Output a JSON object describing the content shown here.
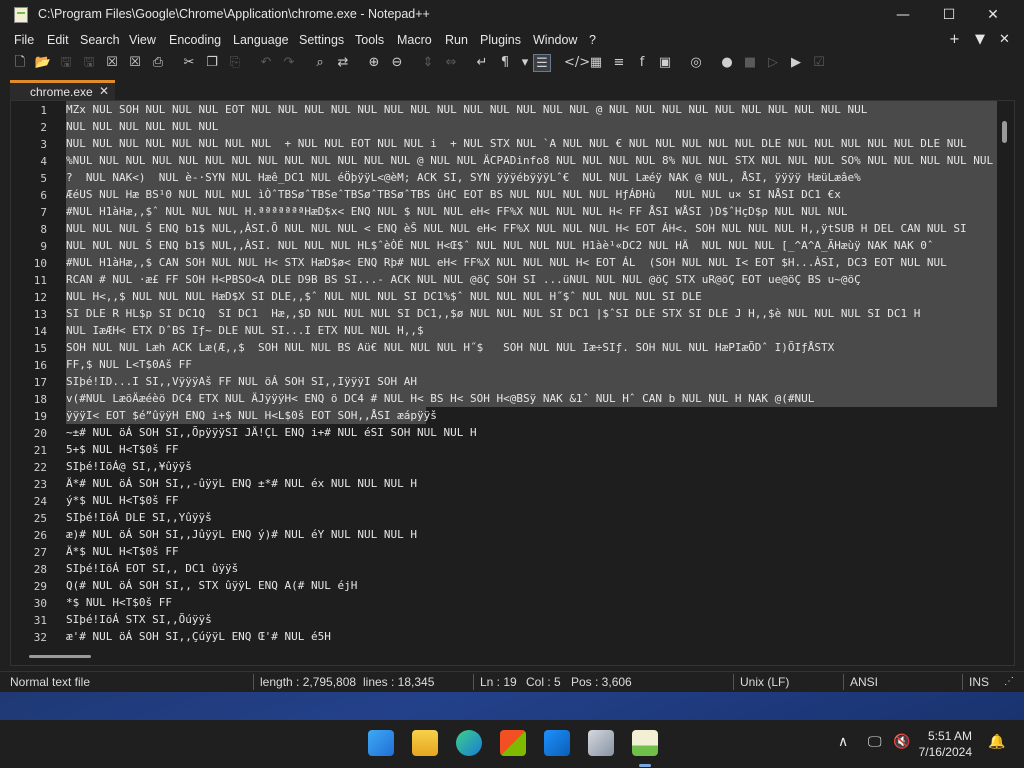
{
  "window": {
    "title": "C:\\Program Files\\Google\\Chrome\\Application\\chrome.exe - Notepad++",
    "minimize": "—",
    "maximize": "☐",
    "close": "✕"
  },
  "menu": {
    "items": [
      "File",
      "Edit",
      "Search",
      "View",
      "Encoding",
      "Language",
      "Settings",
      "Tools",
      "Macro",
      "Run",
      "Plugins",
      "Window",
      "?"
    ],
    "right_plus": "+",
    "right_down": "▼",
    "right_close": "✕"
  },
  "toolbar": {
    "icons": [
      "new-file-icon",
      "open-file-icon",
      "save-icon",
      "save-all-icon",
      "close-icon",
      "close-all-icon",
      "print-icon",
      "cut-icon",
      "copy-icon",
      "paste-icon",
      "undo-icon",
      "redo-icon",
      "find-icon",
      "replace-icon",
      "zoom-in-icon",
      "zoom-out-icon",
      "sync-vertical-icon",
      "sync-horizontal-icon",
      "word-wrap-icon",
      "show-all-chars-icon",
      "indent-guide-icon",
      "xml-tag-icon",
      "document-map-icon",
      "function-list-icon",
      "folder-workspace-icon",
      "monitoring-icon",
      "record-macro-icon",
      "stop-macro-icon",
      "play-macro-icon",
      "run-macro-icon",
      "save-macro-icon"
    ]
  },
  "tabs": [
    {
      "label": "chrome.exe",
      "close": "✕"
    }
  ],
  "editor": {
    "line_numbers": [
      "1",
      "2",
      "3",
      "4",
      "5",
      "6",
      "7",
      "8",
      "9",
      "10",
      "11",
      "12",
      "13",
      "14",
      "15",
      "16",
      "17",
      "18",
      "19",
      "20",
      "21",
      "22",
      "23",
      "24",
      "25",
      "26",
      "27",
      "28",
      "29",
      "30",
      "31",
      "32"
    ],
    "lines": [
      "MZx NUL SOH NUL NUL NUL EOT NUL NUL NUL NUL NUL NUL NUL NUL NUL NUL NUL NUL NUL @ NUL NUL NUL NUL NUL NUL NUL NUL NUL NUL",
      "NUL NUL NUL NUL NUL NUL",
      "NUL NUL NUL NUL NUL NUL NUL NUL  + NUL NUL EOT NUL NUL i  + NUL STX NUL `A NUL NUL € NUL NUL NUL NUL NUL DLE NUL NUL NUL NUL NUL DLE NUL",
      "%NUL NUL NUL NUL NUL NUL NUL NUL NUL NUL NUL NUL NUL @ NUL NUL ÄCPADinfo8 NUL NUL NUL NUL 8% NUL NUL STX NUL NUL NUL SO% NUL NUL NUL NUL NUL",
      "?  NUL NAK<)  NUL è-·SYN NUL Hæê_DC1 NUL éÖþÿÿL<@èM; ACK SI, SYN ÿÿÿébÿÿÿLˆ€  NUL NUL Læéÿ NAK @ NUL, ÅSI, ÿÿÿÿ HæüLæâe%",
      "ÆéUS NUL Hæ BS¹0 NUL NUL NUL ìÒˆTBSøˆTBSeˆTBSøˆTBSøˆTBS ûHC EOT BS NUL NUL NUL NUL HƒÁÐHù   NUL NUL u× SI NÅSI DC1 €x",
      "#NUL H1àHæ,,$ˆ NUL NUL NUL H.ªªªªªªªHæD$x< ENQ NUL $ NUL NUL eH< FF%X NUL NUL NUL H< FF ÅSI WÅSI )D$ˆHçD$p NUL NUL NUL",
      "NUL NUL NUL Š ENQ b1$ NUL,,ÀSI.Õ NUL NUL NUL < ENQ èŠ NUL NUL eH< FF%X NUL NUL NUL H< EOT ÁH<. SOH NUL NUL NUL H,,ÿtSUB H DEL CAN NUL SI",
      "NUL NUL NUL Š ENQ b1$ NUL,,ÀSI. NUL NUL NUL HL$ˆèÒÉ NUL H<Œ$ˆ NUL NUL NUL NUL H1àè¹«DC2 NUL HÄ  NUL NUL NUL [_^A^A_ÃHæùÿ NAK NAK 0ˆ",
      "#NUL H1àHæ,,$ CAN SOH NUL NUL H< STX HæD$ø< ENQ Rþ# NUL eH< FF%X NUL NUL NUL H< EOT ÁL  (SOH NUL NUL I< EOT $H...ÀSI, DC3 EOT NUL NUL",
      "RCAN # NUL ·æ£ FF SOH H<PBSO<A DLE D9B BS SI...- ACK NUL NUL @öÇ SOH SI ...üNUL NUL NUL @öÇ STX uR@öÇ EOT ue@öÇ BS u~@öÇ",
      "NUL H<,,$ NUL NUL NUL HæD$X SI DLE,,$ˆ NUL NUL NUL SI DC1%$ˆ NUL NUL NUL H˝$ˆ NUL NUL NUL SI DLE",
      "SI DLE R HL$p SI DC1Q  SI DC1  Hæ,,$D NUL NUL NUL SI DC1,,$ø NUL NUL NUL SI DC1 |$ˆSI DLE STX SI DLE J H,,$è NUL NUL NUL SI DC1 H",
      "NUL IæÆH< ETX DˆBS Iƒ~ DLE NUL SI...I ETX NUL NUL H,,$",
      "SOH NUL NUL Læh ACK Læ(Æ,,$  SOH NUL NUL BS Aü€ NUL NUL NUL H˝$   SOH NUL NUL Iæ÷SIƒ. SOH NUL NUL HæPIæÕDˆ I)ÕIƒÅSTX",
      "FF,$ NUL L<T$0Aš FF",
      "SIþé!ID...I SI,,VÿÿÿAš FF NUL öÁ SOH SI,,IÿÿÿI SOH AH",
      "v(#NUL LæöÄæéèö DC4 ETX NUL ÄJÿÿÿH< ENQ ö DC4 # NUL H< BS H< SOH H<@BSÿ NAK &1ˆ NUL Hˆ CAN b NUL NUL H NAK @(#NUL",
      "ÿÿÿI< EOT $é”ûÿÿH ENQ i+$ NUL H<L$0š EOT SOH,,ÅSI æápÿÿš",
      "~±# NUL öÁ SOH SI,,ÕpÿÿÿSI JÄ!ÇL ENQ i+# NUL éSI SOH NUL NUL H",
      "5+$ NUL H<T$0š FF",
      "SIþé!IöÁ@ SI,,¥ûÿÿš",
      "Ä*# NUL öÁ SOH SI,,-ûÿÿL ENQ ±*# NUL éx NUL NUL NUL H",
      "ý*$ NUL H<T$0š FF",
      "SIþé!IöÁ DLE SI,,Yûÿÿš",
      "æ)# NUL öÁ SOH SI,,JûÿÿL ENQ ý)# NUL éY NUL NUL NUL H",
      "Ä*$ NUL H<T$0š FF",
      "SIþé!IöÁ EOT SI,, DC1 ûÿÿš",
      "Q(# NUL öÁ SOH SI,, STX ûÿÿL ENQ A(# NUL éjH",
      "*$ NUL H<T$0š FF",
      "SIþé!IöÁ STX SI,,Õúÿÿš",
      "æ'# NUL öÁ SOH SI,,ÇúÿÿL ENQ Œ'# NUL é5H"
    ]
  },
  "status": {
    "filetype": "Normal text file",
    "length": "length : 2,795,808",
    "lines": "lines : 18,345",
    "ln": "Ln : 19",
    "col": "Col : 5",
    "pos": "Pos : 3,606",
    "eol": "Unix (LF)",
    "encoding": "ANSI",
    "mode": "INS"
  },
  "taskbar": {
    "icons": [
      "windows-start-icon",
      "file-explorer-icon",
      "edge-browser-icon",
      "microsoft-store-icon",
      "outlook-icon",
      "snipping-tool-icon",
      "notepad-plus-plus-icon"
    ],
    "tray_chevron": "∧",
    "time": "5:51 AM",
    "date": "7/16/2024"
  }
}
